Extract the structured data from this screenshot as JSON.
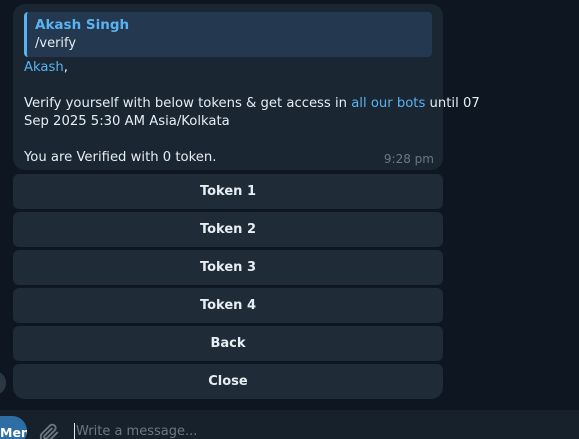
{
  "message": {
    "reply": {
      "name": "Akash Singh",
      "text": "/verify"
    },
    "mention": "Akash",
    "mention_suffix": ",",
    "line1_before": "Verify yourself with below tokens & get access in ",
    "line1_link": "all our bots",
    "line1_after": " until 07",
    "line2": "Sep 2025 5:30 AM Asia/Kolkata",
    "line3": "You are Verified with 0 token.",
    "time": "9:28 pm"
  },
  "keyboard": {
    "buttons": [
      {
        "label": "Token 1"
      },
      {
        "label": "Token 2"
      },
      {
        "label": "Token 3"
      },
      {
        "label": "Token 4"
      },
      {
        "label": "Back"
      },
      {
        "label": "Close"
      }
    ]
  },
  "composer": {
    "menu_label": "Menu",
    "placeholder": "Write a message..."
  },
  "colors": {
    "background": "#0e1621",
    "bubble": "#1a2632",
    "button": "#1f2b37",
    "accent": "#5ab3f0",
    "menu_button": "#2f6ea5"
  },
  "icons": {
    "attach": "paperclip-icon"
  }
}
